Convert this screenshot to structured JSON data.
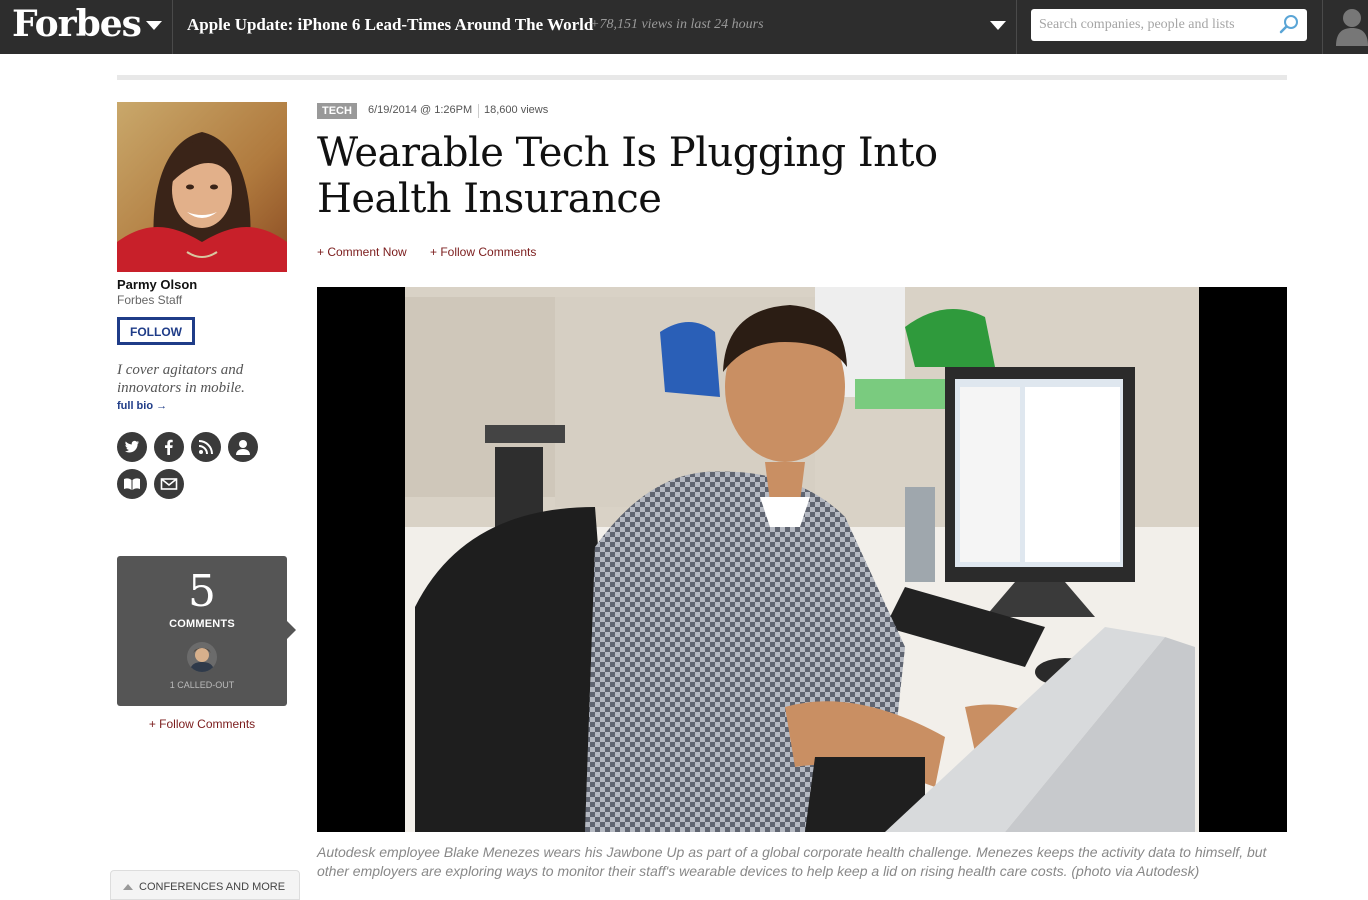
{
  "header": {
    "logo": "Forbes",
    "trending_headline": "Apple Update: iPhone 6 Lead-Times Around The World",
    "trending_views": "+78,151 views in last 24 hours",
    "search_placeholder": "Search companies, people and lists"
  },
  "author": {
    "name": "Parmy Olson",
    "role": "Forbes Staff",
    "follow_label": "FOLLOW",
    "bio": "I cover agitators and innovators in mobile.",
    "full_bio_label": "full bio →",
    "social_icons": [
      "twitter-icon",
      "facebook-icon",
      "rss-icon",
      "profile-icon",
      "book-icon",
      "email-icon"
    ]
  },
  "comments": {
    "count": "5",
    "label": "COMMENTS",
    "called_out": "1 CALLED-OUT",
    "follow_label": "+ Follow Comments"
  },
  "bottom_tab": {
    "label": "CONFERENCES AND MORE"
  },
  "article": {
    "category": "TECH",
    "date": "6/19/2014 @ 1:26PM",
    "views": "18,600 views",
    "title": "Wearable Tech Is Plugging Into Health Insurance",
    "comment_now_label": "+ Comment Now",
    "follow_comments_label": "+ Follow Comments",
    "caption": "Autodesk employee Blake Menezes wears his Jawbone Up as part of a global corporate health challenge. Menezes keeps the activity data to himself, but other employers are exploring ways to monitor their staff's wearable devices to help keep a lid on rising health care costs. (photo via Autodesk)"
  },
  "colors": {
    "topbar": "#2d2d2d",
    "accent_link": "#7b1c1c",
    "follow_blue": "#1f3c88",
    "comment_box": "#555555"
  }
}
